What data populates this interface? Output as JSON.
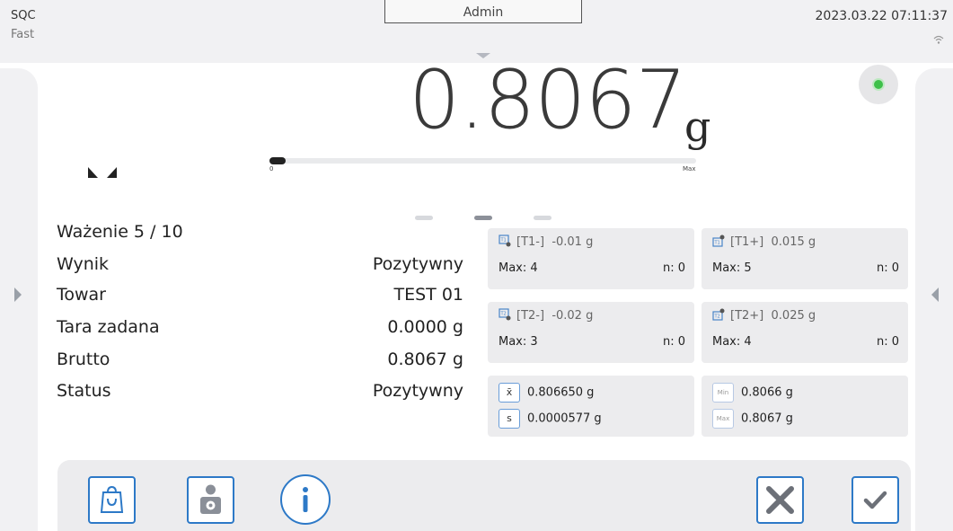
{
  "header": {
    "mode": "SQC",
    "speed": "Fast",
    "user": "Admin",
    "datetime": "2023.03.22 07:11:37"
  },
  "weight": {
    "value": "0.8067",
    "unit": "g",
    "load_fraction": 0.03,
    "load_min_label": "0",
    "load_max_label": "Max"
  },
  "info": [
    {
      "label": "Ważenie 5 / 10",
      "value": ""
    },
    {
      "label": "Wynik",
      "value": "Pozytywny"
    },
    {
      "label": "Towar",
      "value": "TEST 01"
    },
    {
      "label": "Tara zadana",
      "value": "0.0000 g"
    },
    {
      "label": "Brutto",
      "value": "0.8067 g"
    },
    {
      "label": "Status",
      "value": "Pozytywny"
    }
  ],
  "thresholds": {
    "t1_minus": {
      "name": "[T1-]",
      "value": "-0.01 g",
      "max": "Max: 4",
      "n": "n: 0"
    },
    "t1_plus": {
      "name": "[T1+]",
      "value": "0.015 g",
      "max": "Max: 5",
      "n": "n: 0"
    },
    "t2_minus": {
      "name": "[T2-]",
      "value": "-0.02 g",
      "max": "Max: 3",
      "n": "n: 0"
    },
    "t2_plus": {
      "name": "[T2+]",
      "value": "0.025 g",
      "max": "Max: 4",
      "n": "n: 0"
    }
  },
  "stats": {
    "mean_symbol": "x̄",
    "mean": "0.806650 g",
    "sd_symbol": "s",
    "sd": "0.0000577 g",
    "min_symbol": "Min",
    "min": "0.8066 g",
    "max_symbol": "Max",
    "max": "0.8067 g"
  },
  "toolbar": {
    "icons": [
      "product-bag-icon",
      "operator-settings-icon",
      "info-icon",
      "cancel-icon",
      "confirm-icon"
    ]
  },
  "colors": {
    "accent": "#2d79c7",
    "status_ok": "#3ec04a",
    "panel": "#ececee"
  }
}
